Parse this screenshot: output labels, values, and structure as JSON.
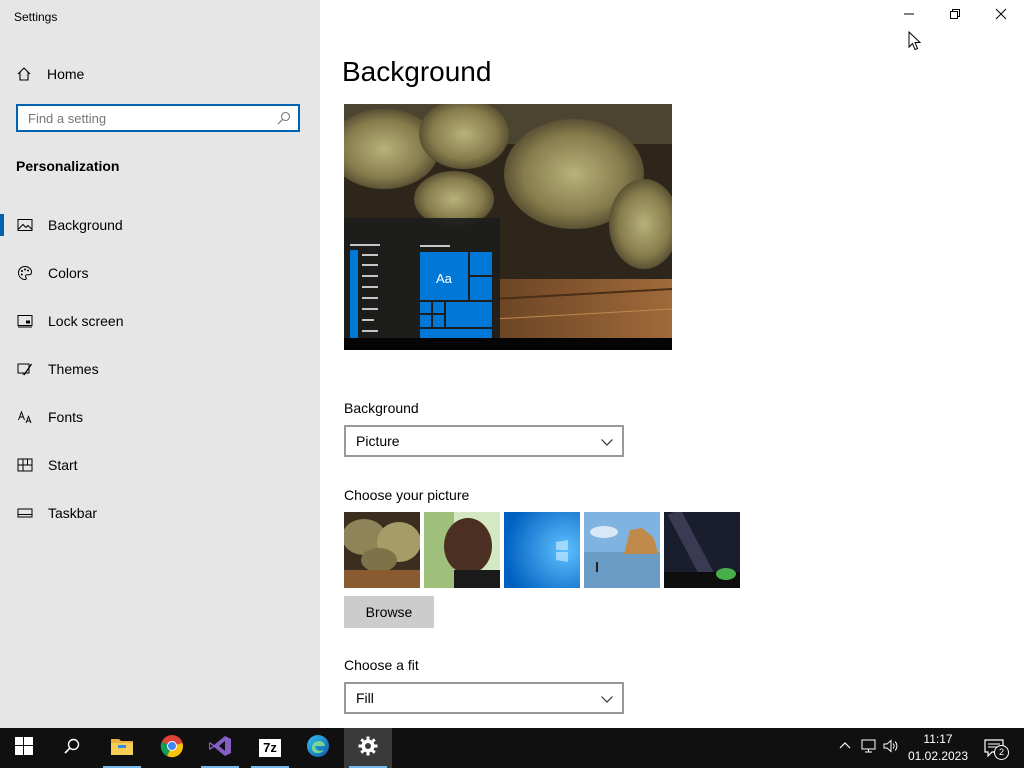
{
  "window": {
    "title": "Settings",
    "controls": {
      "minimize": "minimize",
      "restore": "restore",
      "close": "close"
    }
  },
  "sidebar": {
    "home_label": "Home",
    "search": {
      "placeholder": "Find a setting",
      "value": ""
    },
    "section_title": "Personalization",
    "items": [
      {
        "label": "Background",
        "icon": "picture-icon",
        "active": true
      },
      {
        "label": "Colors",
        "icon": "palette-icon",
        "active": false
      },
      {
        "label": "Lock screen",
        "icon": "lock-screen-icon",
        "active": false
      },
      {
        "label": "Themes",
        "icon": "brush-icon",
        "active": false
      },
      {
        "label": "Fonts",
        "icon": "font-icon",
        "active": false
      },
      {
        "label": "Start",
        "icon": "start-tiles-icon",
        "active": false
      },
      {
        "label": "Taskbar",
        "icon": "taskbar-icon",
        "active": false
      }
    ]
  },
  "main": {
    "title": "Background",
    "preview": {
      "tile_text": "Aa"
    },
    "background": {
      "label": "Background",
      "value": "Picture"
    },
    "picture": {
      "label": "Choose your picture",
      "browse_label": "Browse"
    },
    "fit": {
      "label": "Choose a fit",
      "value": "Fill"
    }
  },
  "taskbar": {
    "apps": [
      "start-icon",
      "search-icon",
      "file-explorer-icon",
      "chrome-icon",
      "visual-studio-icon",
      "7zip-icon",
      "edge-icon",
      "settings-icon"
    ],
    "app_7zip_text": "7z",
    "tray_icons": [
      "chevron-up-icon",
      "network-icon",
      "volume-icon"
    ],
    "clock": {
      "time": "11:17",
      "date": "01.02.2023"
    },
    "notifications_count": "2"
  },
  "colors": {
    "accent": "#0063b1",
    "sidebar_bg": "#e6e6e6",
    "taskbar_bg": "#101010"
  }
}
